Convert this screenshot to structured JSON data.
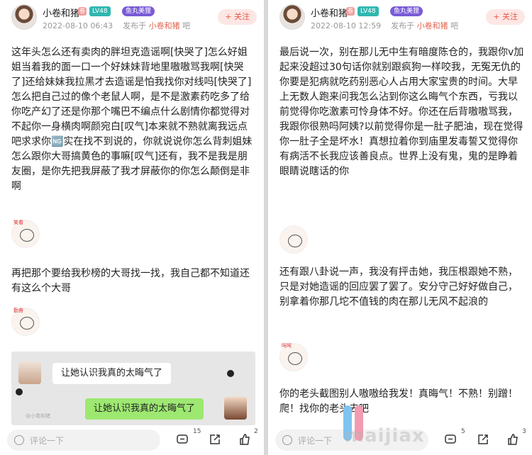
{
  "left": {
    "username": "小卷和猪",
    "badge_tb": "卷",
    "level": "LV48",
    "title_badge": "鱼丸美狸",
    "follow_label": "+ 关注",
    "time": "2022-08-10 06:43",
    "posted_in_prefix": "发布于",
    "posted_in": "小卷和猪",
    "posted_in_suffix": "吧",
    "para1": "这年头怎么还有卖肉的胖坦克造谣啊[快哭了]怎么好姐姐当着我的面一口一个好妹妹背地里嗷嗷骂我啊[快哭了]还给妹妹我拉黑才去造谣是怕我找你对线吗[快哭了]怎么把自己过的像个老鼠人啊，是不是激素药吃多了给你吃产幻了还是你那个嘴巴不编点什么剧情你都觉得对不起你一身横肉啊颜宛白[叹气]本来就不熟就离我远点吧求求你🆖实在找不到说的，你就说说你怎么背刺姐妹怎么跟你大哥搞黄色的事嘛[叹气]还有，我不是我是朋友圈，是你先把我屏蔽了我才屏蔽你的你怎么颠倒是非啊",
    "emoji1_tag": "笑看",
    "para2": "再把那个要给我秒榜的大哥找一找，我自己都不知道还有这么个大哥",
    "emoji2_tag": "勤奋",
    "chat_msg1": "让她认识我真的太晦气了",
    "chat_msg2": "让她认识我真的太晦气了",
    "chat_watermark": "@小卷和猪",
    "comment_placeholder": "评论一下",
    "comment_count": "15",
    "like_count": "2"
  },
  "right": {
    "username": "小卷和猪",
    "badge_tb": "卷",
    "level": "LV48",
    "title_badge": "鱼丸美狸",
    "follow_label": "+ 关注",
    "time": "2022-08-10 12:59",
    "posted_in_prefix": "发布于",
    "posted_in": "小卷和猪",
    "posted_in_suffix": "吧",
    "para1": "最后说一次，别在那儿无中生有暗度陈仓的，我跟你v加起来没超过30句话你就别跟疯狗一样咬我，无冤无仇的你要是犯病就吃药别恶心人占用大家宝贵的时间。大早上无数人跑来问我怎么沾到你这么晦气个东西，亏我以前觉得你吃激素可怜身体不好。你还在后背嗷嗷骂我，我跟你很熟吗阿姨?以前觉得你是一肚子肥油，现在觉得你一肚子全是坏水！真想拉着你到庙里发毒誓又觉得你有病活不长我应该善良点。世界上没有鬼，鬼的是睁着眼睛说瞎话的你",
    "emoji1_tag": "",
    "para2": "还有跟八卦说一声，我没有抨击她，我压根跟她不熟，只是对她造谣的回应罢了罢了。安分守己好好做自己，别拿着你那几坨不值钱的肉在那儿无风不起浪的",
    "emoji2_tag": "呵呵",
    "para3": "你的老头截图别人嗷嗷给我发！真晦气！不熟！别蹭！爬！找你的老头去吧",
    "comment_placeholder": "评论一下",
    "comment_count": "5",
    "like_count": "3"
  },
  "watermark": "maijiax",
  "colors": {
    "accent": "#e7574a",
    "level": "#2fb7b0",
    "title_badge": "#7a5bd6",
    "chat_green": "#9de871"
  }
}
